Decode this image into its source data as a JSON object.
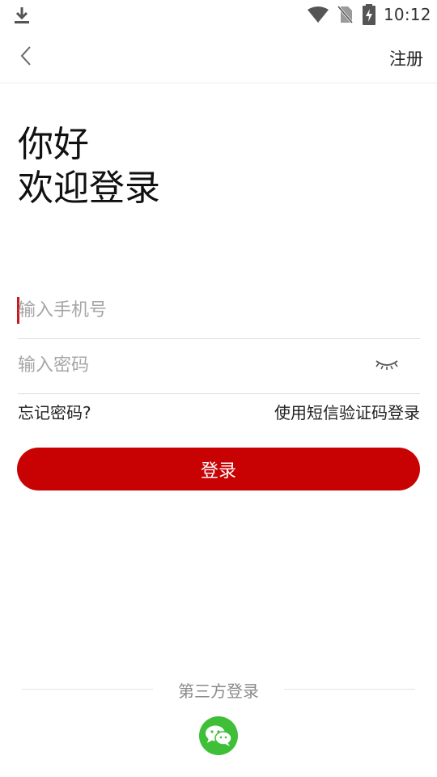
{
  "status_bar": {
    "time": "10:12",
    "icons": [
      "download-icon",
      "wifi-icon",
      "no-sim-icon",
      "battery-charging-icon"
    ]
  },
  "nav": {
    "back_icon": "chevron-left-icon",
    "register_label": "注册"
  },
  "greeting": {
    "line1": "你好",
    "line2": "欢迎登录"
  },
  "form": {
    "phone": {
      "placeholder": "输入手机号",
      "value": ""
    },
    "password": {
      "placeholder": "输入密码",
      "value": "",
      "toggle_icon": "eye-closed-icon"
    },
    "forgot_label": "忘记密码?",
    "sms_login_label": "使用短信验证码登录",
    "submit_label": "登录"
  },
  "third_party": {
    "label": "第三方登录",
    "providers": [
      {
        "name": "wechat",
        "icon": "wechat-icon"
      }
    ]
  },
  "colors": {
    "accent": "#c80103",
    "wechat": "#3ebf37",
    "placeholder": "#a6a6a6",
    "divider": "#dcdcdc"
  }
}
